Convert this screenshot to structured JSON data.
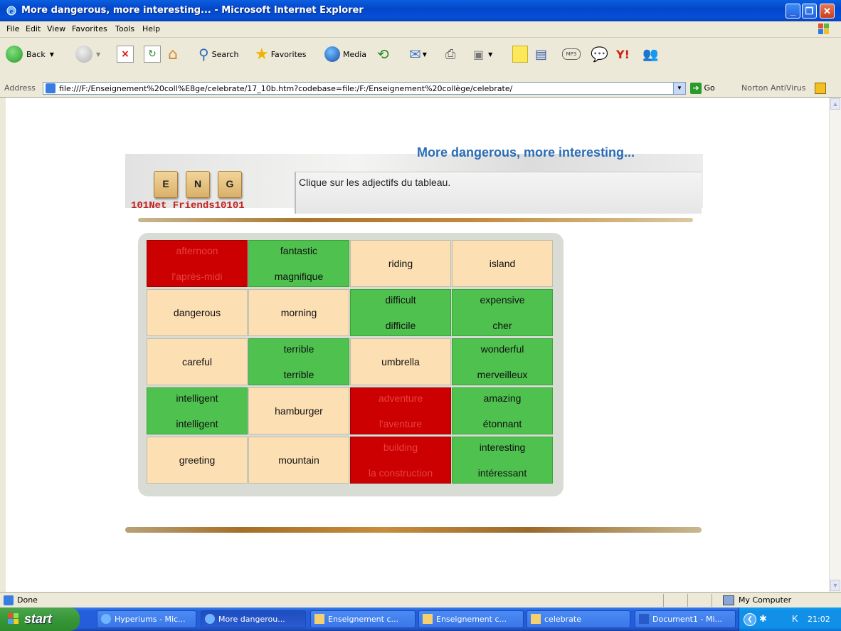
{
  "window": {
    "title": "More dangerous, more interesting... - Microsoft Internet Explorer"
  },
  "menu": [
    "File",
    "Edit",
    "View",
    "Favorites",
    "Tools",
    "Help"
  ],
  "toolbar": {
    "back": "Back",
    "search": "Search",
    "favorites": "Favorites",
    "media": "Media"
  },
  "address": {
    "label": "Address",
    "url": "file:///F:/Enseignement%20coll%E8ge/celebrate/17_10b.htm?codebase=file:/F:/Enseignement%20collège/celebrate/",
    "go": "Go",
    "norton": "Norton AntiVirus"
  },
  "page": {
    "title": "More dangerous, more interesting...",
    "instruction": "Clique sur les adjectifs du tableau.",
    "tiles": [
      "E",
      "N",
      "G"
    ],
    "brand": "101Net Friends10101"
  },
  "grid": [
    [
      {
        "en": "afternoon",
        "fr": "l'après-midi",
        "state": "red"
      },
      {
        "en": "fantastic",
        "fr": "magnifique",
        "state": "green"
      },
      {
        "en": "riding",
        "fr": "",
        "state": "plain"
      },
      {
        "en": "island",
        "fr": "",
        "state": "plain"
      }
    ],
    [
      {
        "en": "dangerous",
        "fr": "",
        "state": "plain"
      },
      {
        "en": "morning",
        "fr": "",
        "state": "plain"
      },
      {
        "en": "difficult",
        "fr": "difficile",
        "state": "green"
      },
      {
        "en": "expensive",
        "fr": "cher",
        "state": "green"
      }
    ],
    [
      {
        "en": "careful",
        "fr": "",
        "state": "plain"
      },
      {
        "en": "terrible",
        "fr": "terrible",
        "state": "green"
      },
      {
        "en": "umbrella",
        "fr": "",
        "state": "plain"
      },
      {
        "en": "wonderful",
        "fr": "merveilleux",
        "state": "green"
      }
    ],
    [
      {
        "en": "intelligent",
        "fr": "intelligent",
        "state": "green"
      },
      {
        "en": "hamburger",
        "fr": "",
        "state": "plain"
      },
      {
        "en": "adventure",
        "fr": "l'aventure",
        "state": "red"
      },
      {
        "en": "amazing",
        "fr": "étonnant",
        "state": "green"
      }
    ],
    [
      {
        "en": "greeting",
        "fr": "",
        "state": "plain"
      },
      {
        "en": "mountain",
        "fr": "",
        "state": "plain"
      },
      {
        "en": "building",
        "fr": "la construction",
        "state": "red"
      },
      {
        "en": "interesting",
        "fr": "intéressant",
        "state": "green"
      }
    ]
  ],
  "status": {
    "left": "Done",
    "zone": "My Computer"
  },
  "taskbar": {
    "start": "start",
    "tasks": [
      "Hyperiums - Mic...",
      "More dangerou...",
      "Enseignement c...",
      "Enseignement c...",
      "celebrate",
      "Document1 - Mi..."
    ],
    "clock": "21:02"
  },
  "colors": {
    "green": "#4fc14f",
    "red": "#cc0000",
    "plain": "#fddfb4",
    "title": "#2a6cb6"
  }
}
